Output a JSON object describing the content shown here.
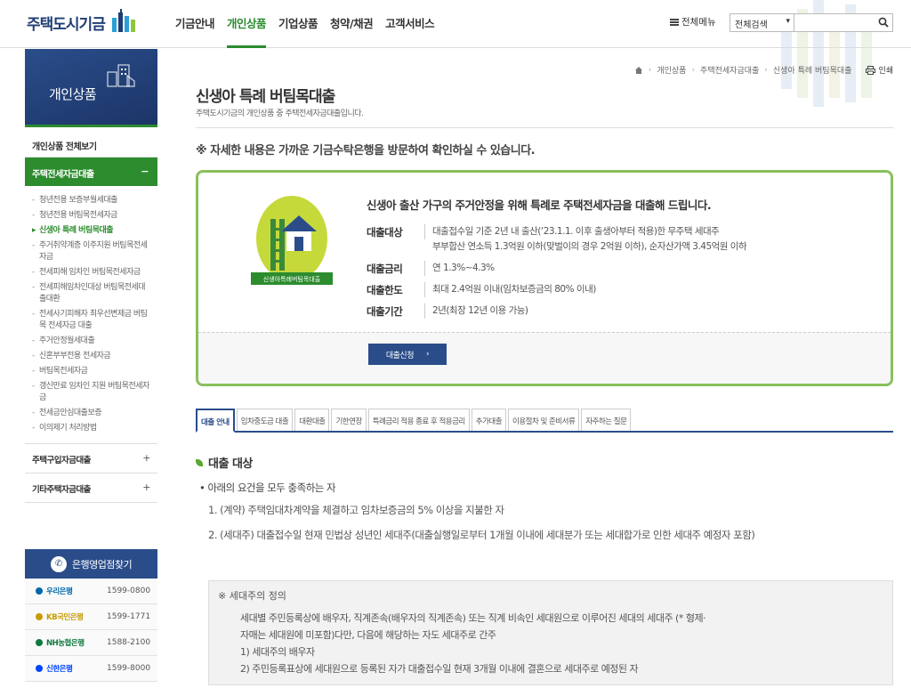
{
  "header": {
    "logo_text": "주택도시기금",
    "gnb": [
      "기금안내",
      "개인상품",
      "기업상품",
      "청약/채권",
      "고객서비스"
    ],
    "active_gnb": 1,
    "allmenu_label": "전체메뉴",
    "search_scope": "전체검색",
    "search_placeholder": ""
  },
  "sidebar": {
    "hero_title": "개인상품",
    "all_link": "개인상품 전체보기",
    "active_category": "주택전세자금대출",
    "active_toggle": "−",
    "sub_items": [
      "청년전용 보증부월세대출",
      "청년전용 버팀목전세자금",
      "신생아 특례 버팀목대출",
      "주거취약계층 이주지원 버팀목전세자금",
      "전세피해 임차인 버팀목전세자금",
      "전세피해임차인대상 버팀목전세대출대환",
      "전세사기피해자 최우선변제금 버팀목 전세자금 대출",
      "주거안정월세대출",
      "신혼부부전용 전세자금",
      "버팀목전세자금",
      "갱신만료 임차인 지원 버팀목전세자금",
      "전세금안심대출보증",
      "이의제기 처리방법"
    ],
    "current_sub": 2,
    "other_categories": [
      {
        "label": "주택구입자금대출",
        "toggle": "+"
      },
      {
        "label": "기타주택자금대출",
        "toggle": "+"
      }
    ],
    "bank_finder": {
      "title": "은행영업점찾기",
      "banks": [
        {
          "name": "우리은행",
          "tel": "1599-0800",
          "color": "#0067ac"
        },
        {
          "name": "KB국민은행",
          "tel": "1599-1771",
          "color": "#c89b00"
        },
        {
          "name": "NH농협은행",
          "tel": "1588-2100",
          "color": "#0f7a3e"
        },
        {
          "name": "신한은행",
          "tel": "1599-8000",
          "color": "#0046ff"
        }
      ]
    }
  },
  "breadcrumb": [
    "개인상품",
    "주택전세자금대출",
    "신생아 특례 버팀목대출"
  ],
  "print_label": "인쇄",
  "page": {
    "title": "신생아 특례 버팀목대출",
    "desc": "주택도시기금의 개인상품 중 주택전세자금대출입니다.",
    "notice": "※ 자세한 내용은 가까운 기금수탁은행을 방문하여 확인하실 수 있습니다."
  },
  "product": {
    "badge_label": "신생아특례버팀목대출",
    "headline": "신생아 출산 가구의 주거안정을 위해 특례로 주택전세자금을 대출해 드립니다.",
    "rows": [
      {
        "label": "대출대상",
        "lines": [
          "대출접수일 기준 2년 내 출산(‘23.1.1. 이후 출생아부터 적용)한 무주택 세대주",
          "부부합산 연소득 1.3억원 이하(맞벌이의 경우 2억원 이하), 순자산가액 3.45억원 이하"
        ]
      },
      {
        "label": "대출금리",
        "lines": [
          "연 1.3%~4.3%"
        ]
      },
      {
        "label": "대출한도",
        "lines": [
          "최대 2.4억원 이내(임차보증금의 80% 이내)"
        ]
      },
      {
        "label": "대출기간",
        "lines": [
          "2년(최장 12년 이용 가능)"
        ]
      }
    ],
    "apply_label": "대출신청"
  },
  "tabs": [
    "대출 안내",
    "임차중도금 대출",
    "대환대출",
    "기한연장",
    "특례금리 적용 종료 후 적용금리",
    "추가대출",
    "이용절차 및 준비서류",
    "자주하는 질문"
  ],
  "active_tab": 0,
  "section": {
    "title": "대출 대상",
    "bullet": "• 아래의 요건을 모두 충족하는 자",
    "req1": "1. (계약) 주택임대차계약을 체결하고 임차보증금의 5% 이상을 지불한 자",
    "req2": "2. (세대주) 대출접수일 현재 민법상 성년인 세대주(대출실행일로부터 1개월 이내에 세대분가 또는 세대합가로 인한 세대주 예정자 포함)"
  },
  "definition": {
    "title": "※ 세대주의 정의",
    "lines": [
      "세대별 주민등록상에 배우자, 직계존속(배우자의 직계존속) 또는 직계 비속인 세대원으로 이루어진 세대의 세대주 (* 형제·",
      "자매는 세대원에 미포함)다만, 다음에 해당하는 자도 세대주로 간주",
      "1) 세대주의 배우자",
      "2) 주민등록표상에 세대원으로 등록된 자가 대출접수일 현재 3개월 이내에 결혼으로 세대주로 예정된 자"
    ]
  },
  "colors": {
    "brand_navy": "#2a4d8a",
    "brand_green": "#2c8c2e",
    "box_border": "#8ac05c"
  }
}
